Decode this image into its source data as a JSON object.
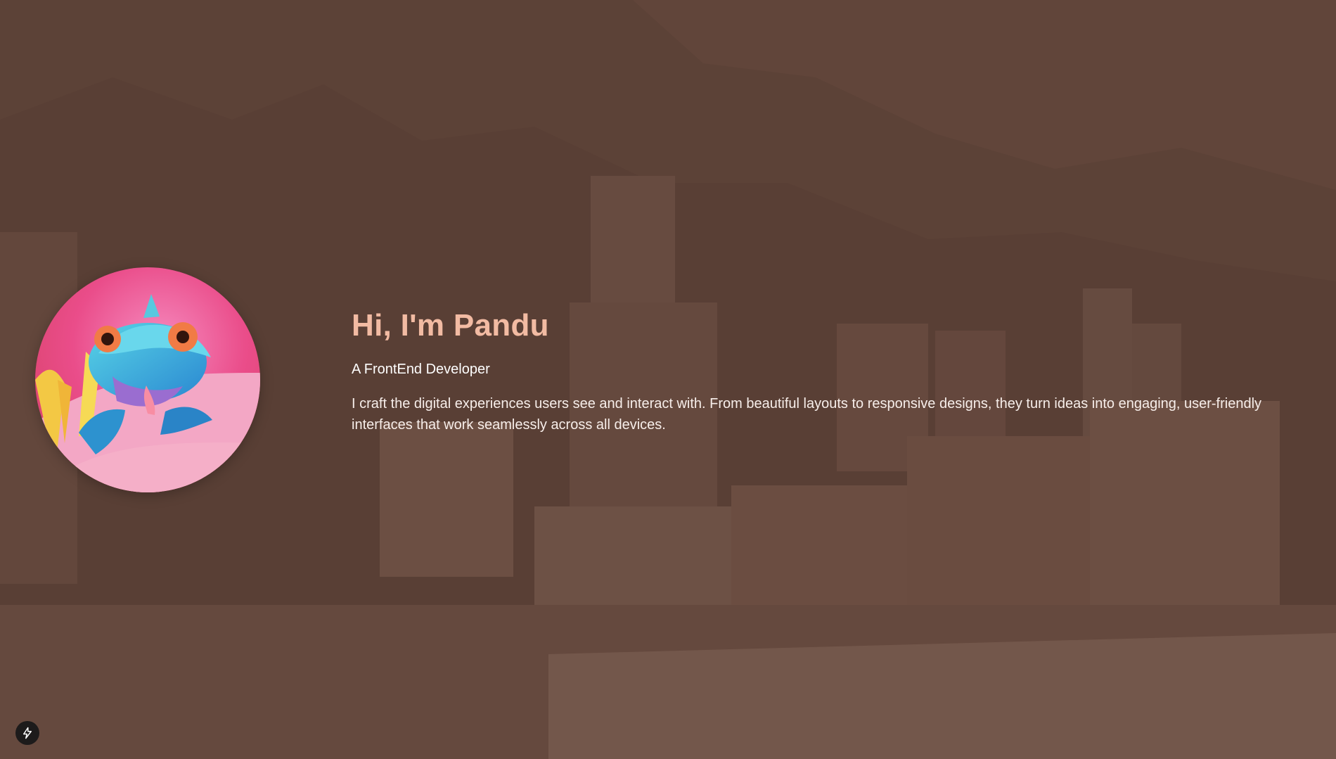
{
  "hero": {
    "title": "Hi, I'm Pandu",
    "subtitle": "A FrontEnd Developer",
    "description": "I craft the digital experiences users see and interact with. From beautiful layouts to responsive designs, they turn ideas into engaging, user-friendly interfaces that work seamlessly across all devices."
  },
  "avatar": {
    "icon": "chameleon-avatar"
  },
  "corner_button": {
    "icon": "lightning-bolt-icon"
  },
  "colors": {
    "overlay": "#5f463d",
    "title": "#f2bba3",
    "text": "#ffffff",
    "button": "#1d1b1b"
  }
}
